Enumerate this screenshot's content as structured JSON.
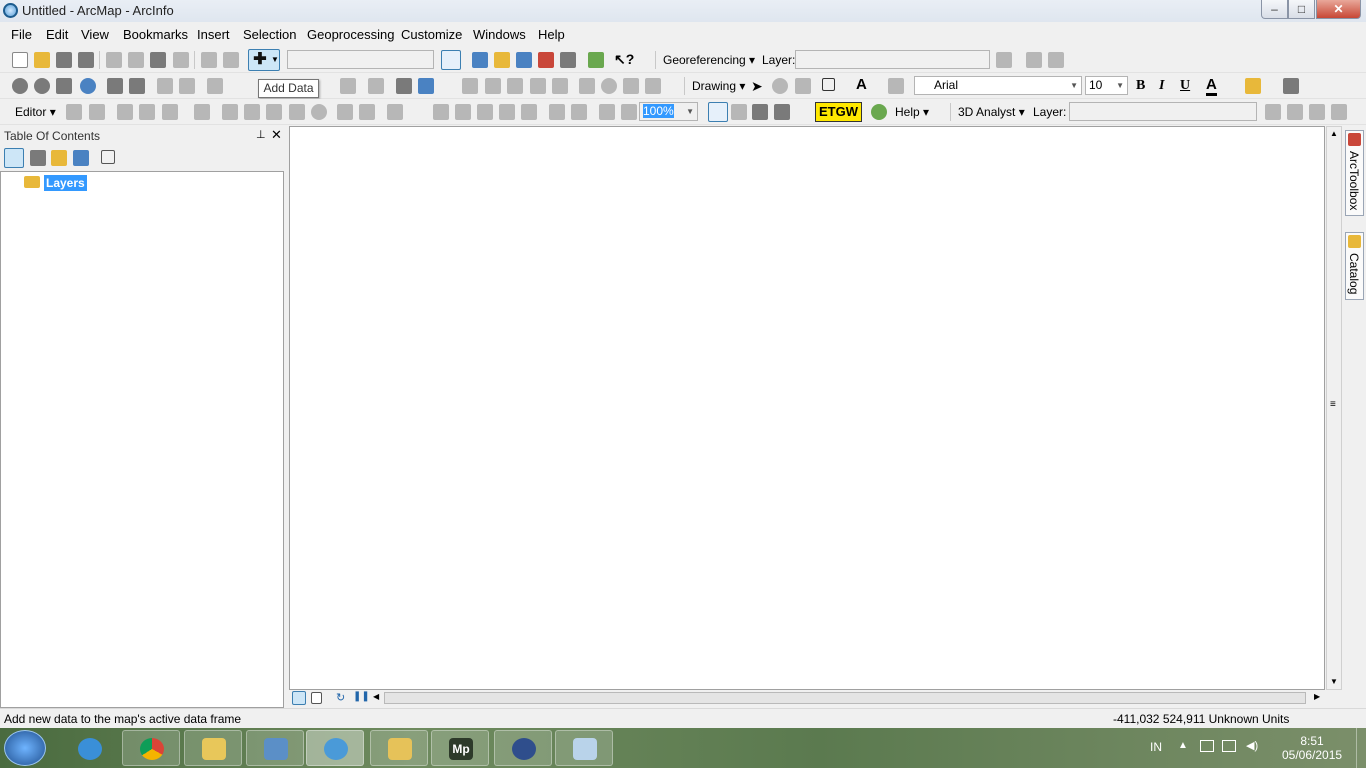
{
  "window": {
    "title": "Untitled - ArcMap - ArcInfo",
    "min": "–",
    "max": "□",
    "close": "✕"
  },
  "menu": [
    "File",
    "Edit",
    "View",
    "Bookmarks",
    "Insert",
    "Selection",
    "Geoprocessing",
    "Customize",
    "Windows",
    "Help"
  ],
  "toolbar1": {
    "georef_label": "Georeferencing",
    "layer_label": "Layer:",
    "scale_value": "",
    "layer_value": ""
  },
  "toolbar2": {
    "drawing_label": "Drawing",
    "font_value": "Arial",
    "size_value": "10",
    "bold": "B",
    "italic": "I",
    "underline": "U",
    "font_color": "A"
  },
  "toolbar3": {
    "editor_label": "Editor",
    "zoom_value": "100%",
    "etgw_label": "ETGW",
    "help_label": "Help",
    "analyst_label": "3D Analyst",
    "layer_label": "Layer:",
    "layer_value": ""
  },
  "tooltip": "Add Data",
  "toc": {
    "title": "Table Of Contents",
    "root_layer": "Layers",
    "pin": "⊥",
    "close": "✕"
  },
  "right_tabs": [
    "ArcToolbox",
    "Catalog"
  ],
  "status": {
    "message": "Add new data to the map's active data frame",
    "coordinates": "-411,032  524,911 Unknown Units"
  },
  "taskbar": {
    "lang": "IN",
    "time": "8:51",
    "date": "05/06/2015"
  }
}
